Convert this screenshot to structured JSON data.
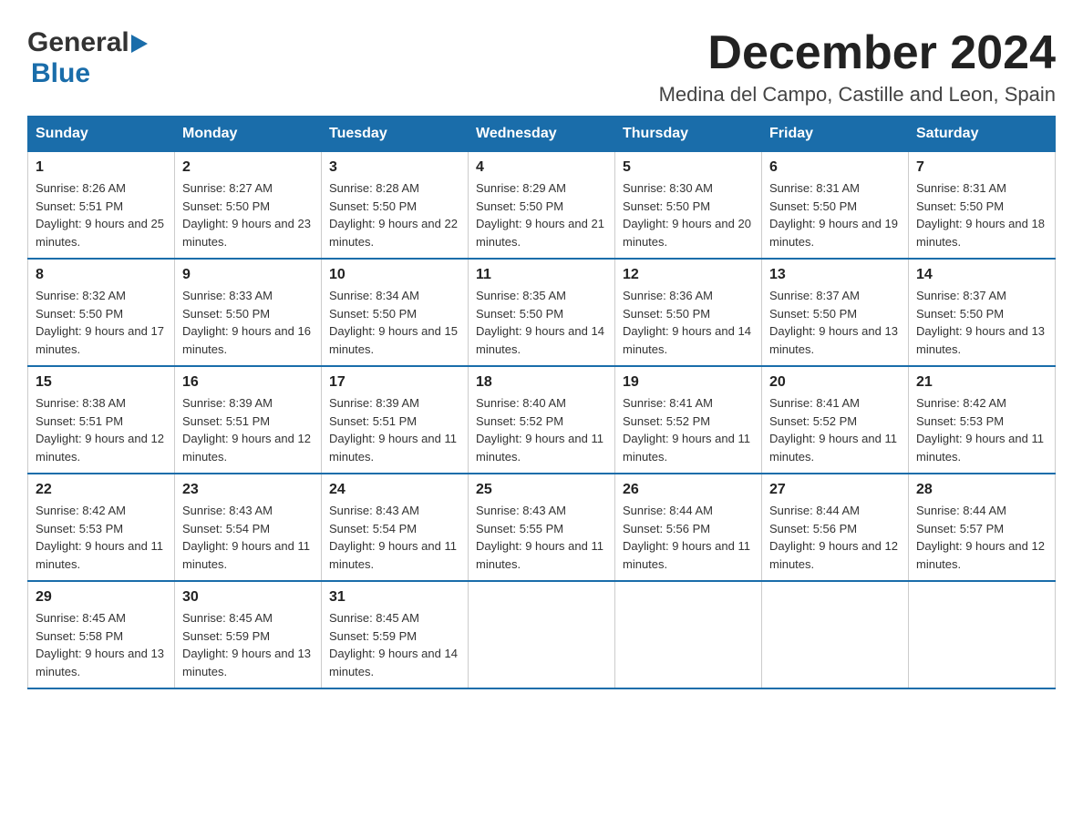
{
  "header": {
    "logo_general": "General",
    "logo_blue": "Blue",
    "month_title": "December 2024",
    "location": "Medina del Campo, Castille and Leon, Spain"
  },
  "weekdays": [
    "Sunday",
    "Monday",
    "Tuesday",
    "Wednesday",
    "Thursday",
    "Friday",
    "Saturday"
  ],
  "weeks": [
    [
      {
        "day": "1",
        "sunrise": "8:26 AM",
        "sunset": "5:51 PM",
        "daylight": "9 hours and 25 minutes."
      },
      {
        "day": "2",
        "sunrise": "8:27 AM",
        "sunset": "5:50 PM",
        "daylight": "9 hours and 23 minutes."
      },
      {
        "day": "3",
        "sunrise": "8:28 AM",
        "sunset": "5:50 PM",
        "daylight": "9 hours and 22 minutes."
      },
      {
        "day": "4",
        "sunrise": "8:29 AM",
        "sunset": "5:50 PM",
        "daylight": "9 hours and 21 minutes."
      },
      {
        "day": "5",
        "sunrise": "8:30 AM",
        "sunset": "5:50 PM",
        "daylight": "9 hours and 20 minutes."
      },
      {
        "day": "6",
        "sunrise": "8:31 AM",
        "sunset": "5:50 PM",
        "daylight": "9 hours and 19 minutes."
      },
      {
        "day": "7",
        "sunrise": "8:31 AM",
        "sunset": "5:50 PM",
        "daylight": "9 hours and 18 minutes."
      }
    ],
    [
      {
        "day": "8",
        "sunrise": "8:32 AM",
        "sunset": "5:50 PM",
        "daylight": "9 hours and 17 minutes."
      },
      {
        "day": "9",
        "sunrise": "8:33 AM",
        "sunset": "5:50 PM",
        "daylight": "9 hours and 16 minutes."
      },
      {
        "day": "10",
        "sunrise": "8:34 AM",
        "sunset": "5:50 PM",
        "daylight": "9 hours and 15 minutes."
      },
      {
        "day": "11",
        "sunrise": "8:35 AM",
        "sunset": "5:50 PM",
        "daylight": "9 hours and 14 minutes."
      },
      {
        "day": "12",
        "sunrise": "8:36 AM",
        "sunset": "5:50 PM",
        "daylight": "9 hours and 14 minutes."
      },
      {
        "day": "13",
        "sunrise": "8:37 AM",
        "sunset": "5:50 PM",
        "daylight": "9 hours and 13 minutes."
      },
      {
        "day": "14",
        "sunrise": "8:37 AM",
        "sunset": "5:50 PM",
        "daylight": "9 hours and 13 minutes."
      }
    ],
    [
      {
        "day": "15",
        "sunrise": "8:38 AM",
        "sunset": "5:51 PM",
        "daylight": "9 hours and 12 minutes."
      },
      {
        "day": "16",
        "sunrise": "8:39 AM",
        "sunset": "5:51 PM",
        "daylight": "9 hours and 12 minutes."
      },
      {
        "day": "17",
        "sunrise": "8:39 AM",
        "sunset": "5:51 PM",
        "daylight": "9 hours and 11 minutes."
      },
      {
        "day": "18",
        "sunrise": "8:40 AM",
        "sunset": "5:52 PM",
        "daylight": "9 hours and 11 minutes."
      },
      {
        "day": "19",
        "sunrise": "8:41 AM",
        "sunset": "5:52 PM",
        "daylight": "9 hours and 11 minutes."
      },
      {
        "day": "20",
        "sunrise": "8:41 AM",
        "sunset": "5:52 PM",
        "daylight": "9 hours and 11 minutes."
      },
      {
        "day": "21",
        "sunrise": "8:42 AM",
        "sunset": "5:53 PM",
        "daylight": "9 hours and 11 minutes."
      }
    ],
    [
      {
        "day": "22",
        "sunrise": "8:42 AM",
        "sunset": "5:53 PM",
        "daylight": "9 hours and 11 minutes."
      },
      {
        "day": "23",
        "sunrise": "8:43 AM",
        "sunset": "5:54 PM",
        "daylight": "9 hours and 11 minutes."
      },
      {
        "day": "24",
        "sunrise": "8:43 AM",
        "sunset": "5:54 PM",
        "daylight": "9 hours and 11 minutes."
      },
      {
        "day": "25",
        "sunrise": "8:43 AM",
        "sunset": "5:55 PM",
        "daylight": "9 hours and 11 minutes."
      },
      {
        "day": "26",
        "sunrise": "8:44 AM",
        "sunset": "5:56 PM",
        "daylight": "9 hours and 11 minutes."
      },
      {
        "day": "27",
        "sunrise": "8:44 AM",
        "sunset": "5:56 PM",
        "daylight": "9 hours and 12 minutes."
      },
      {
        "day": "28",
        "sunrise": "8:44 AM",
        "sunset": "5:57 PM",
        "daylight": "9 hours and 12 minutes."
      }
    ],
    [
      {
        "day": "29",
        "sunrise": "8:45 AM",
        "sunset": "5:58 PM",
        "daylight": "9 hours and 13 minutes."
      },
      {
        "day": "30",
        "sunrise": "8:45 AM",
        "sunset": "5:59 PM",
        "daylight": "9 hours and 13 minutes."
      },
      {
        "day": "31",
        "sunrise": "8:45 AM",
        "sunset": "5:59 PM",
        "daylight": "9 hours and 14 minutes."
      },
      null,
      null,
      null,
      null
    ]
  ],
  "labels": {
    "sunrise_prefix": "Sunrise: ",
    "sunset_prefix": "Sunset: ",
    "daylight_prefix": "Daylight: "
  }
}
